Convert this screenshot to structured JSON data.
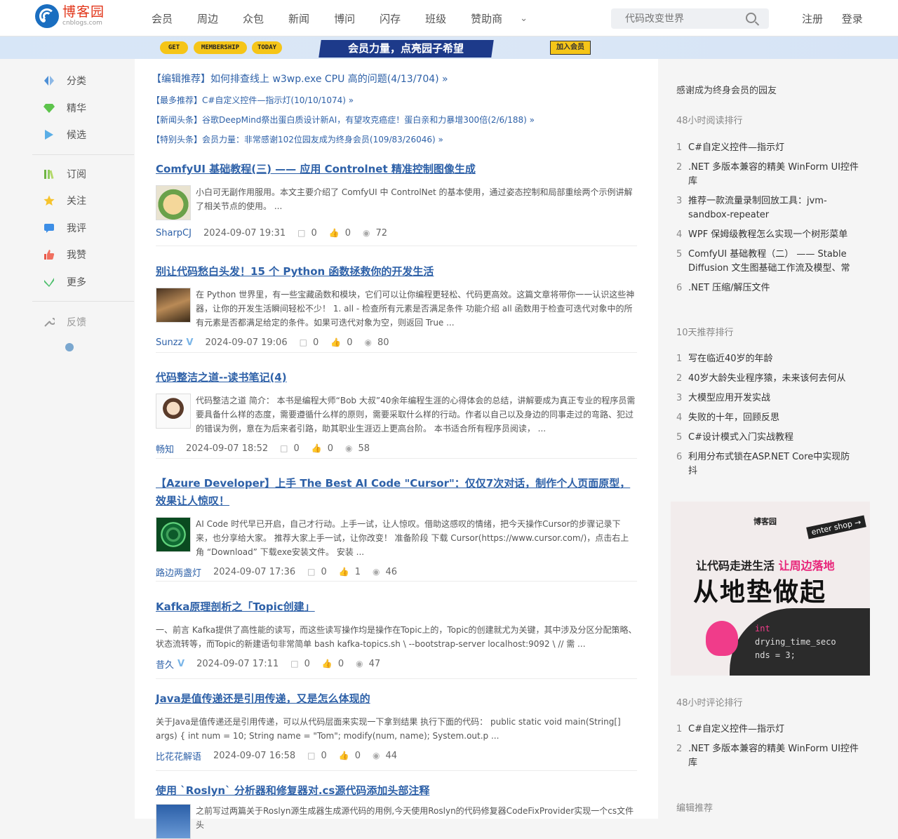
{
  "logo": {
    "cn": "博客园",
    "en": "cnblogs.com"
  },
  "nav": {
    "items": [
      "会员",
      "周边",
      "众包",
      "新闻",
      "博问",
      "闪存",
      "班级",
      "赞助商"
    ],
    "more_icon": "chevron-down-icon"
  },
  "search": {
    "placeholder": "代码改变世界"
  },
  "auth": {
    "register": "注册",
    "login": "登录"
  },
  "banner": {
    "pill1": "GET",
    "pill2": "MEMBERSHIP",
    "pill3": "TODAY",
    "slogan": "会员力量，点亮园子希望",
    "join": "加入会员"
  },
  "sidebar": {
    "group1": [
      {
        "icon": "category-icon",
        "label": "分类"
      },
      {
        "icon": "diamond-icon",
        "label": "精华"
      },
      {
        "icon": "candidate-icon",
        "label": "候选"
      }
    ],
    "group2": [
      {
        "icon": "subscribe-icon",
        "label": "订阅"
      },
      {
        "icon": "star-icon",
        "label": "关注"
      },
      {
        "icon": "comment-icon",
        "label": "我评"
      },
      {
        "icon": "thumbs-up-icon",
        "label": "我赞"
      },
      {
        "icon": "more-check-icon",
        "label": "更多"
      }
    ],
    "feedback": {
      "icon": "wrench-icon",
      "label": "反馈"
    }
  },
  "headlines": [
    "【编辑推荐】如何排查线上 w3wp.exe CPU 高的问题(4/13/704) »",
    "【最多推荐】C#自定义控件—指示灯(10/10/1074) »",
    "【新闻头条】谷歌DeepMind祭出蛋白质设计新AI，有望攻克癌症！蛋白亲和力暴增300倍(2/6/188) »",
    "【特别头条】会员力量：非常感谢102位园友成为终身会员(109/83/26046) »"
  ],
  "posts": [
    {
      "title": "ComfyUI 基础教程(三) —— 应用 Controlnet 精准控制图像生成",
      "summary": "小白可无副作用服用。本文主要介绍了 ComfyUI 中 ControlNet 的基本使用，通过姿态控制和局部重绘两个示例讲解了相关节点的使用。 ...",
      "author": "SharpCJ",
      "verified": false,
      "date": "2024-09-07 19:31",
      "comments": "0",
      "likes": "0",
      "views": "72"
    },
    {
      "title": "别让代码愁白头发！15 个 Python 函数拯救你的开发生活",
      "summary": "在 Python 世界里，有一些宝藏函数和模块，它们可以让你编程更轻松、代码更高效。这篇文章将带你一一认识这些神器，让你的开发生活瞬间轻松不少！ 1. all - 检查所有元素是否满足条件 功能介绍 all 函数用于检查可迭代对象中的所有元素是否都满足给定的条件。如果可迭代对象为空，则返回 True ...",
      "author": "Sunzz",
      "verified": true,
      "date": "2024-09-07 19:06",
      "comments": "0",
      "likes": "0",
      "views": "80"
    },
    {
      "title": "代码整洁之道--读书笔记(4)",
      "summary": "代码整洁之道 简介： 本书是编程大师“Bob 大叔”40余年编程生涯的心得体会的总结，讲解要成为真正专业的程序员需要具备什么样的态度，需要遵循什么样的原则，需要采取什么样的行动。作者以自己以及身边的同事走过的弯路、犯过的错误为例，意在为后来者引路，助其职业生涯迈上更高台阶。 本书适合所有程序员阅读， ...",
      "author": "畅知",
      "verified": false,
      "date": "2024-09-07 18:52",
      "comments": "0",
      "likes": "0",
      "views": "58"
    },
    {
      "title": "【Azure Developer】上手 The Best AI Code \"Cursor\"：仅仅7次对话，制作个人页面原型，效果让人惊叹！",
      "summary": "AI Code 时代早已开启，自己才行动。上手一试，让人惊叹。借助这感叹的情绪，把今天操作Cursor的步骤记录下来，也分享给大家。 推荐大家上手一试，让你改变！ 准备阶段 下载 Cursor(https://www.cursor.com/)，点击右上角 “Download” 下载exe安装文件。 安装 ...",
      "author": "路边两盏灯",
      "verified": false,
      "date": "2024-09-07 17:36",
      "comments": "0",
      "likes": "1",
      "views": "46"
    },
    {
      "title": "Kafka原理剖析之「Topic创建」",
      "summary": "一、前言 Kafka提供了高性能的读写，而这些读写操作均是操作在Topic上的，Topic的创建就尤为关键，其中涉及分区分配策略、状态流转等，而Topic的新建语句非常简单 bash kafka-topics.sh \\ --bootstrap-server localhost:9092 \\ // 需 ...",
      "author": "昔久",
      "verified": true,
      "date": "2024-09-07 17:11",
      "comments": "0",
      "likes": "0",
      "views": "47"
    },
    {
      "title": "Java是值传递还是引用传递，又是怎么体现的",
      "summary": "关于Java是值传递还是引用传递，可以从代码层面来实现一下拿到结果 执行下面的代码： public static void main(String[] args) { int num = 10; String name = \"Tom\"; modify(num, name); System.out.p ...",
      "author": "比花花解语",
      "verified": false,
      "date": "2024-09-07 16:58",
      "comments": "0",
      "likes": "0",
      "views": "44"
    },
    {
      "title": "使用 `Roslyn` 分析器和修复器对.cs源代码添加头部注释",
      "summary": "之前写过两篇关于Roslyn源生成器生成源代码的用例,今天使用Roslyn的代码修复器CodeFixProvider实现一个cs文件头",
      "author": "",
      "verified": false,
      "date": "",
      "comments": "",
      "likes": "",
      "views": ""
    }
  ],
  "right": {
    "thanks": "感谢成为终身会员的园友",
    "rank48_title": "48小时阅读排行",
    "rank48": [
      "C#自定义控件—指示灯",
      ".NET 多版本兼容的精美 WinForm UI控件库",
      "推荐一款流量录制回放工具：jvm-sandbox-repeater",
      "WPF 保姆级教程怎么实现一个树形菜单",
      "ComfyUI 基础教程（二） —— Stable Diffusion 文生图基础工作流及模型、常",
      ".NET 压缩/解压文件"
    ],
    "rank10_title": "10天推荐排行",
    "rank10": [
      "写在临近40岁的年龄",
      "40岁大龄失业程序猿，未来该何去何从",
      "大模型应用开发实战",
      "失败的十年，回顾反思",
      "C#设计模式入门实战教程",
      "利用分布式锁在ASP.NET Core中实现防抖"
    ],
    "ad": {
      "brand": "博客园",
      "shop": "enter shop →",
      "line1a": "让代码走进生活",
      "line1b": "让周边落地",
      "line2": "从地垫做起",
      "code1": "int",
      "code2": "drying_time_seco",
      "code3": "nds = 3;"
    },
    "comment_title": "48小时评论排行",
    "comment_rank": [
      "C#自定义控件—指示灯",
      ".NET 多版本兼容的精美 WinForm UI控件库"
    ],
    "editor_title": "编辑推荐"
  },
  "colors": {
    "link": "#2e61a8",
    "brand": "#1a6ec0",
    "logo_text": "#e2361a"
  }
}
